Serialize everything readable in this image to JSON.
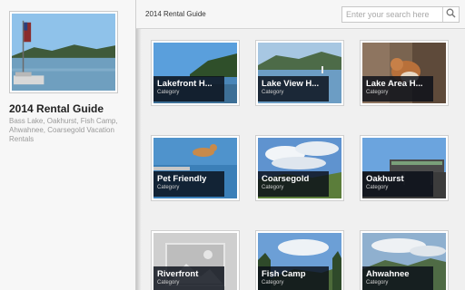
{
  "sidebar": {
    "guide_title": "2014 Rental Guide",
    "guide_subtitle": "Bass Lake, Oakhurst, Fish Camp, Ahwahnee, Coarsegold Vacation Rentals"
  },
  "topbar": {
    "title": "2014 Rental Guide",
    "search_placeholder": "Enter your search here"
  },
  "tiles": [
    {
      "name": "Lakefront H...",
      "type": "Category"
    },
    {
      "name": "Lake View H...",
      "type": "Category"
    },
    {
      "name": "Lake Area H...",
      "type": "Category"
    },
    {
      "name": "Pet Friendly",
      "type": "Category"
    },
    {
      "name": "Coarsegold",
      "type": "Category"
    },
    {
      "name": "Oakhurst",
      "type": "Category"
    },
    {
      "name": "Riverfront",
      "type": "Category"
    },
    {
      "name": "Fish Camp",
      "type": "Category"
    },
    {
      "name": "Ahwahnee",
      "type": "Category"
    }
  ]
}
